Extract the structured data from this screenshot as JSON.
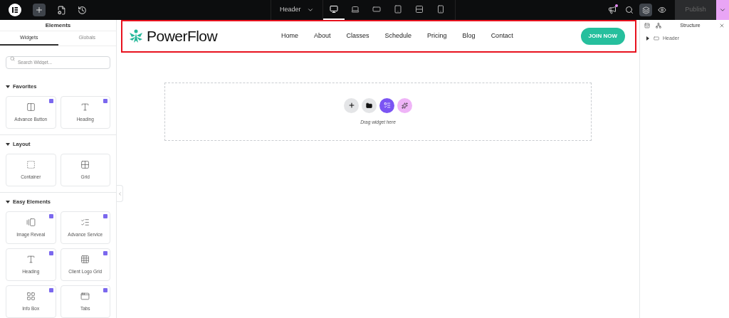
{
  "top_bar": {
    "document": "Header",
    "devices": [
      {
        "selected": true
      },
      {
        "selected": false
      },
      {
        "selected": false
      },
      {
        "selected": false
      },
      {
        "selected": false
      },
      {
        "selected": false
      }
    ],
    "notification": true,
    "structure_active": true,
    "publish": {
      "label": "Publish",
      "disabled": true
    }
  },
  "elements_panel": {
    "title": "Elements",
    "tabs": [
      {
        "label": "Widgets",
        "selected": true
      },
      {
        "label": "Globals",
        "selected": false
      }
    ],
    "search": {
      "placeholder": "Search Widget..."
    },
    "sections": [
      {
        "title": "Favorites",
        "expanded": true,
        "widgets": [
          {
            "label": "Advance Button",
            "pro": true
          },
          {
            "label": "Heading",
            "pro": true
          }
        ]
      },
      {
        "title": "Layout",
        "expanded": true,
        "widgets": [
          {
            "label": "Container",
            "pro": false
          },
          {
            "label": "Grid",
            "pro": false
          }
        ]
      },
      {
        "title": "Easy Elements",
        "expanded": true,
        "widgets": [
          {
            "label": "Image Reveal",
            "pro": true
          },
          {
            "label": "Advance Service",
            "pro": true
          },
          {
            "label": "Heading",
            "pro": true
          },
          {
            "label": "Client Logo Grid",
            "pro": true
          },
          {
            "label": "Info Box",
            "pro": true
          },
          {
            "label": "Tabs",
            "pro": true
          }
        ]
      }
    ]
  },
  "canvas": {
    "header": {
      "selected": true,
      "brand": "PowerFlow",
      "nav": [
        "Home",
        "About",
        "Classes",
        "Schedule",
        "Pricing",
        "Blog",
        "Contact"
      ],
      "cta": "JOIN NOW"
    },
    "drop_zone": {
      "hint": "Drag widget here"
    }
  },
  "structure_panel": {
    "title": "Structure",
    "tree": [
      {
        "label": "Header",
        "expanded": false
      }
    ]
  }
}
